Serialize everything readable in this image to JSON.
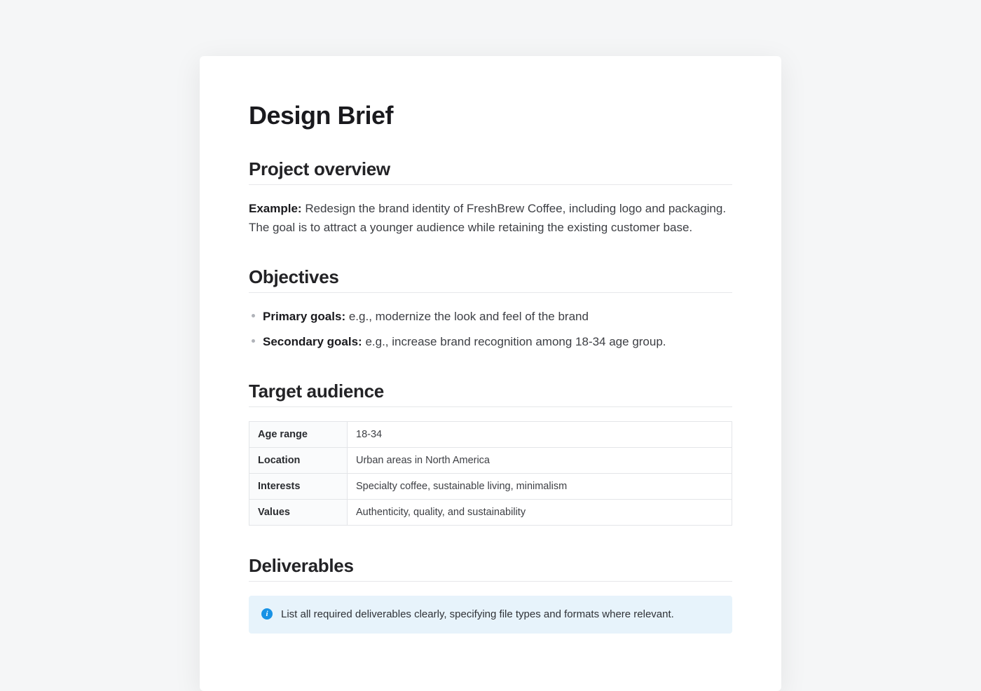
{
  "title": "Design Brief",
  "sections": {
    "overview": {
      "heading": "Project overview",
      "example_label": "Example:",
      "example_text": "Redesign the brand identity of FreshBrew Coffee, including logo and packaging. The goal is to attract a younger audience while retaining the existing customer base."
    },
    "objectives": {
      "heading": "Objectives",
      "items": [
        {
          "label": "Primary goals:",
          "text": "e.g., modernize the look and feel of the brand"
        },
        {
          "label": "Secondary goals:",
          "text": "e.g., increase brand recognition among 18-34 age group."
        }
      ]
    },
    "audience": {
      "heading": "Target audience",
      "rows": [
        {
          "key": "Age range",
          "value": "18-34"
        },
        {
          "key": "Location",
          "value": "Urban areas in North America"
        },
        {
          "key": "Interests",
          "value": "Specialty coffee, sustainable living, minimalism"
        },
        {
          "key": "Values",
          "value": "Authenticity, quality, and sustainability"
        }
      ]
    },
    "deliverables": {
      "heading": "Deliverables",
      "callout": "List all required deliverables clearly, specifying file types and formats where relevant."
    }
  }
}
